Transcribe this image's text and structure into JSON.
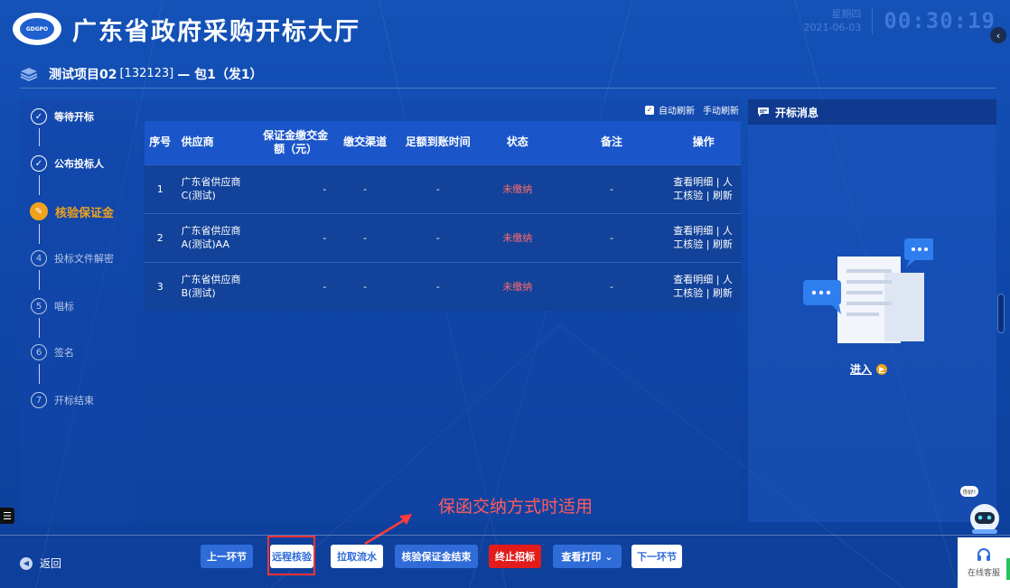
{
  "header": {
    "logo_text": "GDGPO",
    "title": "广东省政府采购开标大厅",
    "date_label": "星期四",
    "date": "2021-06-03",
    "clock": "00:30:19"
  },
  "project": {
    "name": "测试项目02",
    "code": "[132123]",
    "package": "— 包1（发1）"
  },
  "steps": [
    {
      "number": "",
      "label": "等待开标",
      "state": "done"
    },
    {
      "number": "",
      "label": "公布投标人",
      "state": "done"
    },
    {
      "number": "",
      "label": "核验保证金",
      "state": "active"
    },
    {
      "number": "4",
      "label": "投标文件解密",
      "state": "pending"
    },
    {
      "number": "5",
      "label": "唱标",
      "state": "pending"
    },
    {
      "number": "6",
      "label": "签名",
      "state": "pending"
    },
    {
      "number": "7",
      "label": "开标结束",
      "state": "pending"
    }
  ],
  "refresh": {
    "auto_label": "自动刷新",
    "manual_label": "手动刷新",
    "auto_checked": true
  },
  "table": {
    "headers": [
      "序号",
      "供应商",
      "保证金缴交金额（元）",
      "缴交渠道",
      "足额到账时间",
      "状态",
      "备注",
      "操作"
    ],
    "rows": [
      {
        "no": "1",
        "supplier": "广东省供应商C(测试)",
        "amount": "-",
        "channel": "-",
        "time": "-",
        "status": "未缴纳",
        "note": "-",
        "ops": "查看明细 | 人工核验 | 刷新"
      },
      {
        "no": "2",
        "supplier": "广东省供应商A(测试)AA",
        "amount": "-",
        "channel": "-",
        "time": "-",
        "status": "未缴纳",
        "note": "-",
        "ops": "查看明细 | 人工核验 | 刷新"
      },
      {
        "no": "3",
        "supplier": "广东省供应商B(测试)",
        "amount": "-",
        "channel": "-",
        "time": "-",
        "status": "未缴纳",
        "note": "-",
        "ops": "查看明细 | 人工核验 | 刷新"
      }
    ]
  },
  "messages": {
    "title": "开标消息",
    "enter_label": "进入"
  },
  "annotation": {
    "text": "保函交纳方式时适用"
  },
  "footer": {
    "back_label": "返回",
    "buttons": {
      "prev": "上一环节",
      "remote_verify": "远程核验",
      "pull_flow": "拉取流水",
      "verify_end": "核验保证金结束",
      "stop": "终止招标",
      "print": "查看打印",
      "next": "下一环节"
    }
  },
  "service": {
    "label": "在线客服",
    "bubble": "你好!"
  },
  "colors": {
    "accent_orange": "#f0a21c",
    "status_red": "#ff6b6b",
    "stop_red": "#e21b1b",
    "button_blue": "#2f6cd8"
  }
}
